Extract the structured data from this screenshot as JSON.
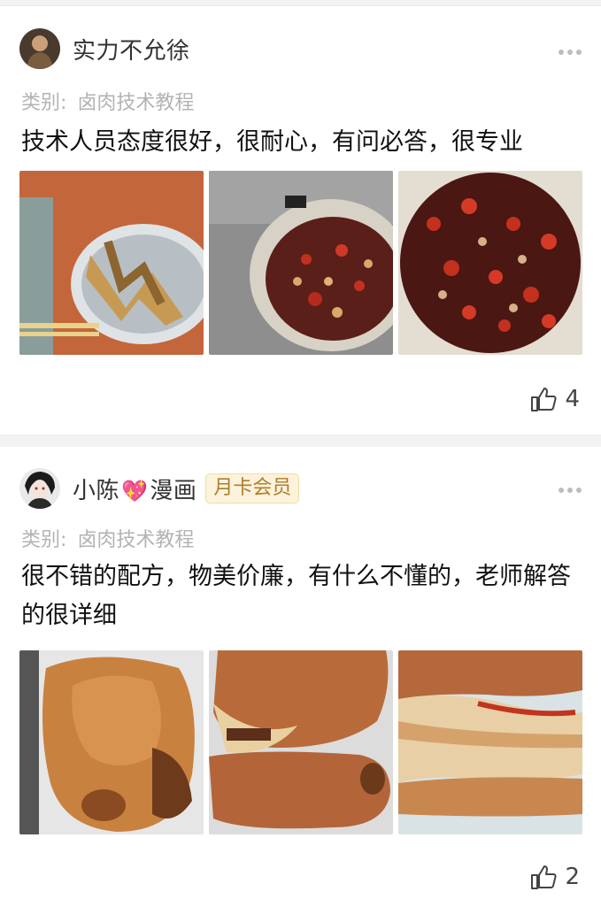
{
  "reviews": [
    {
      "username": "实力不允徐",
      "category_label": "类别:",
      "category_value": "卤肉技术教程",
      "text": "技术人员态度很好，很耐心，有问必答，很专业",
      "likes": "4",
      "images": [
        "chicken-feet-photo",
        "chili-pot-photo",
        "chili-brine-closeup-photo"
      ]
    },
    {
      "username_part1": "小陈",
      "username_heart": "💖",
      "username_part2": "漫画",
      "badge": "月卡会员",
      "category_label": "类别:",
      "category_value": "卤肉技术教程",
      "text": "很不错的配方，物美价廉，有什么不懂的，老师解答的很详细",
      "likes": "2",
      "images": [
        "braised-pork-trotter-photo",
        "pork-trotters-photo",
        "sliced-trotter-photo"
      ]
    }
  ],
  "icons": {
    "more": "more-dots-icon",
    "like": "thumbs-up-icon"
  }
}
